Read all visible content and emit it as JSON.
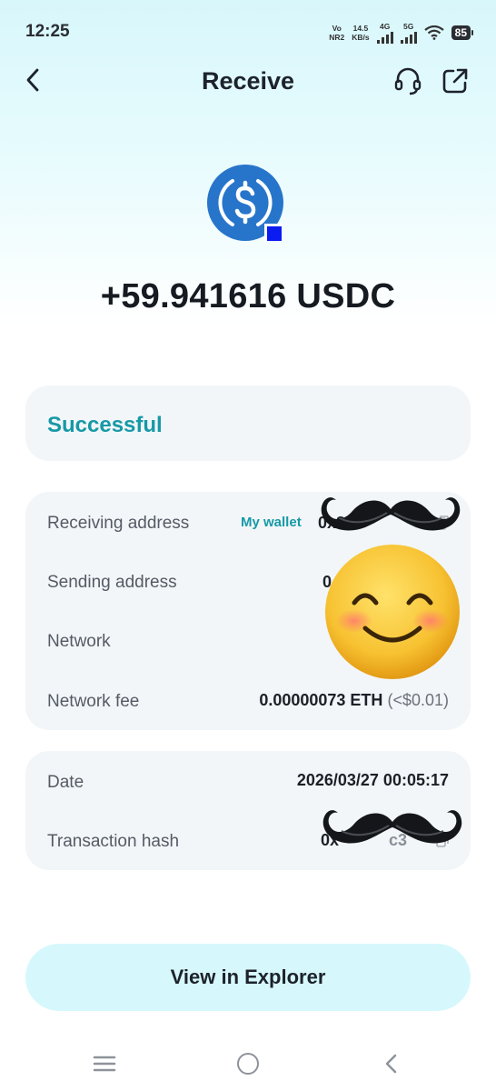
{
  "status_bar": {
    "time": "12:25",
    "carrier_top": "Vo",
    "carrier_bottom": "NR2",
    "speed_value": "14.5",
    "speed_unit": "KB/s",
    "net1": "4G",
    "net2": "5G",
    "battery": "85"
  },
  "header": {
    "title": "Receive",
    "back_icon": "chevron-left-icon",
    "support_icon": "headset-icon",
    "share_icon": "external-link-icon"
  },
  "token": {
    "icon": "usdc-icon",
    "amount": "+59.941616 USDC",
    "brand_color": "#2775ca",
    "badge_color": "#0a1cf0"
  },
  "status": {
    "text": "Successful",
    "color": "#1699a7"
  },
  "details": {
    "receiving_address_label": "Receiving address",
    "wallet_tag": "My wallet",
    "receiving_address_partial": "0x84",
    "sending_address_label": "Sending address",
    "sending_address_partial": "0",
    "network_label": "Network",
    "network_fee_label": "Network fee",
    "network_fee_value": "0.00000073 ETH",
    "network_fee_fiat": "(<$0.01)"
  },
  "date_card": {
    "date_label": "Date",
    "date_value": "2026/03/27 00:05:17",
    "tx_hash_label": "Transaction hash",
    "tx_hash_partial": "0x",
    "tx_hash_tail": "c3"
  },
  "actions": {
    "explorer_label": "View in Explorer"
  }
}
